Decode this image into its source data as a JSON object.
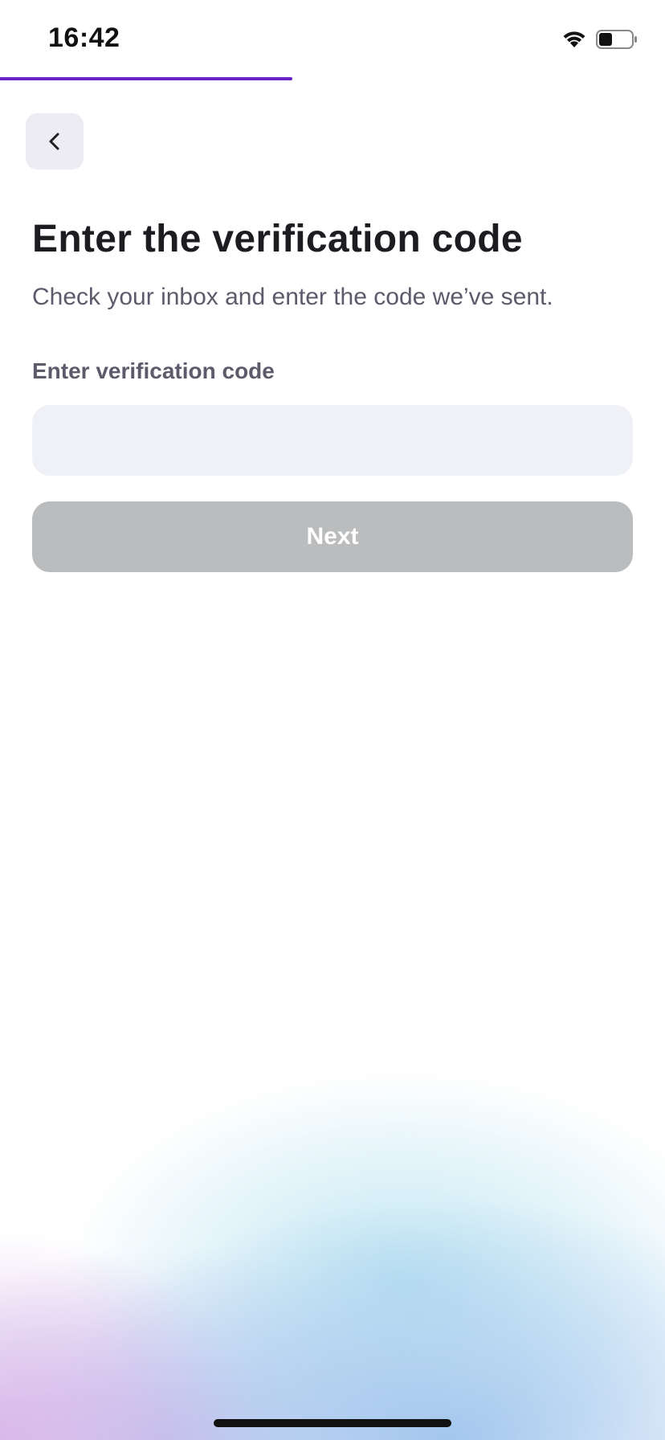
{
  "status_bar": {
    "time": "16:42",
    "wifi_icon": "wifi-icon",
    "battery_icon": "battery-icon",
    "battery_level": 0.4
  },
  "progress": {
    "value": 0.44,
    "color": "#6a22c9"
  },
  "header": {
    "back_icon": "chevron-left-icon"
  },
  "main": {
    "title": "Enter the verification code",
    "subtitle": "Check your inbox and enter the code we’ve sent.",
    "field_label": "Enter verification code",
    "code_value": "",
    "next_label": "Next",
    "next_disabled": true
  },
  "colors": {
    "accent": "#6a22c9",
    "button_disabled": "#babcbe",
    "input_bg": "#f0f1f6"
  }
}
